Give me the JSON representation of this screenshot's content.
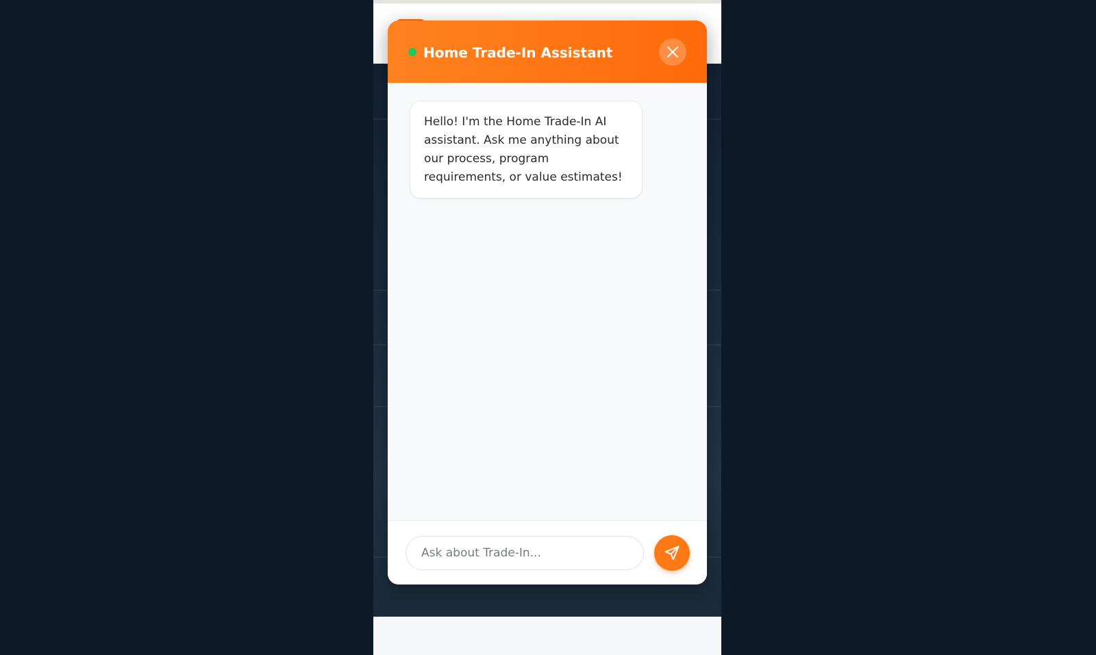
{
  "chat": {
    "title": "Home Trade-In Assistant",
    "status": "online",
    "icons": {
      "status": "status-dot-icon",
      "close": "close-icon",
      "send": "send-icon"
    },
    "messages": [
      {
        "role": "assistant",
        "text": "Hello! I'm the Home Trade-In AI assistant. Ask me anything about our process, program requirements, or value estimates!"
      }
    ],
    "input": {
      "value": "",
      "placeholder": "Ask about Trade-In..."
    }
  },
  "colors": {
    "accent": "#ff7a14",
    "header_gradient_start": "#ff8220",
    "header_gradient_end": "#ff6a0a",
    "status_online": "#22c55e",
    "page_background": "#0e1a2a"
  }
}
